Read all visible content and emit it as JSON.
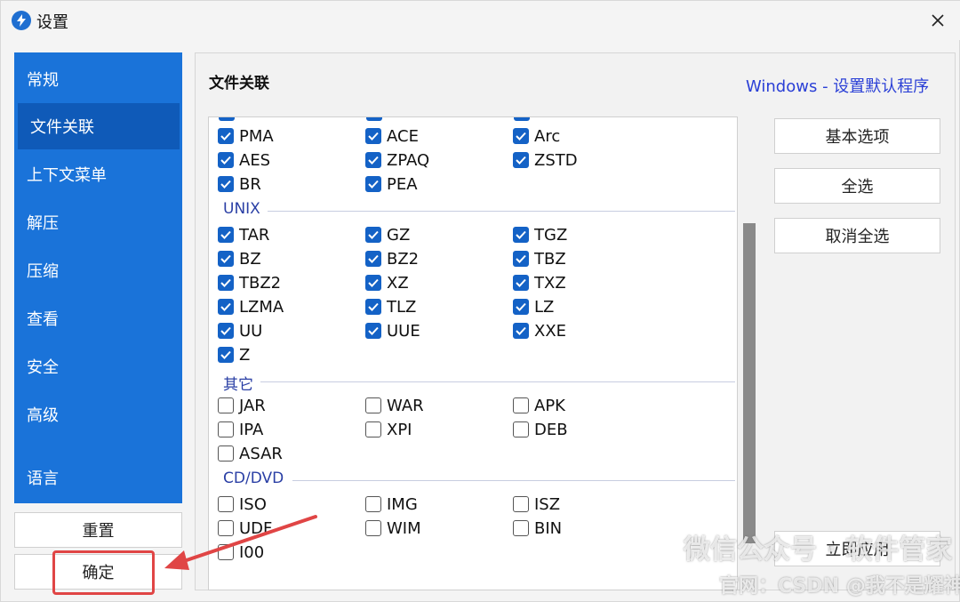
{
  "window": {
    "title": "设置"
  },
  "sidebar": {
    "items": [
      {
        "label": "常规",
        "active": false
      },
      {
        "label": "文件关联",
        "active": true
      },
      {
        "label": "上下文菜单",
        "active": false
      },
      {
        "label": "解压",
        "active": false
      },
      {
        "label": "压缩",
        "active": false
      },
      {
        "label": "查看",
        "active": false
      },
      {
        "label": "安全",
        "active": false
      },
      {
        "label": "高级",
        "active": false
      },
      {
        "label": "语言",
        "active": false
      }
    ],
    "reset_label": "重置",
    "ok_label": "确定"
  },
  "main": {
    "title": "文件关联",
    "windows_link": "Windows - 设置默认程序",
    "groups": [
      {
        "label": "UNIX"
      },
      {
        "label": "其它"
      },
      {
        "label": "CD/DVD"
      }
    ],
    "items": [
      {
        "label": "PMA",
        "checked": true
      },
      {
        "label": "ACE",
        "checked": true
      },
      {
        "label": "Arc",
        "checked": true
      },
      {
        "label": "AES",
        "checked": true
      },
      {
        "label": "ZPAQ",
        "checked": true
      },
      {
        "label": "ZSTD",
        "checked": true
      },
      {
        "label": "BR",
        "checked": true
      },
      {
        "label": "PEA",
        "checked": true
      },
      {
        "label": "TAR",
        "checked": true
      },
      {
        "label": "GZ",
        "checked": true
      },
      {
        "label": "TGZ",
        "checked": true
      },
      {
        "label": "BZ",
        "checked": true
      },
      {
        "label": "BZ2",
        "checked": true
      },
      {
        "label": "TBZ",
        "checked": true
      },
      {
        "label": "TBZ2",
        "checked": true
      },
      {
        "label": "XZ",
        "checked": true
      },
      {
        "label": "TXZ",
        "checked": true
      },
      {
        "label": "LZMA",
        "checked": true
      },
      {
        "label": "TLZ",
        "checked": true
      },
      {
        "label": "LZ",
        "checked": true
      },
      {
        "label": "UU",
        "checked": true
      },
      {
        "label": "UUE",
        "checked": true
      },
      {
        "label": "XXE",
        "checked": true
      },
      {
        "label": "Z",
        "checked": true
      },
      {
        "label": "JAR",
        "checked": false
      },
      {
        "label": "WAR",
        "checked": false
      },
      {
        "label": "APK",
        "checked": false
      },
      {
        "label": "IPA",
        "checked": false
      },
      {
        "label": "XPI",
        "checked": false
      },
      {
        "label": "DEB",
        "checked": false
      },
      {
        "label": "ASAR",
        "checked": false
      },
      {
        "label": "ISO",
        "checked": false
      },
      {
        "label": "IMG",
        "checked": false
      },
      {
        "label": "ISZ",
        "checked": false
      },
      {
        "label": "UDF",
        "checked": false
      },
      {
        "label": "WIM",
        "checked": false
      },
      {
        "label": "BIN",
        "checked": false
      },
      {
        "label": "I00",
        "checked": false
      }
    ]
  },
  "buttons": {
    "basic_options": "基本选项",
    "select_all": "全选",
    "deselect_all": "取消全选",
    "apply_now": "立即应用"
  },
  "watermarks": {
    "line1": "微信公众号 · 软件管家",
    "line2": "官网：CSDN @我不是耀神"
  },
  "colors": {
    "sidebar": "#1a73d9",
    "sidebar_active": "#0f5ab8",
    "checkbox_checked": "#1462c6",
    "link": "#2a3fd6",
    "annotation": "#e04545"
  }
}
